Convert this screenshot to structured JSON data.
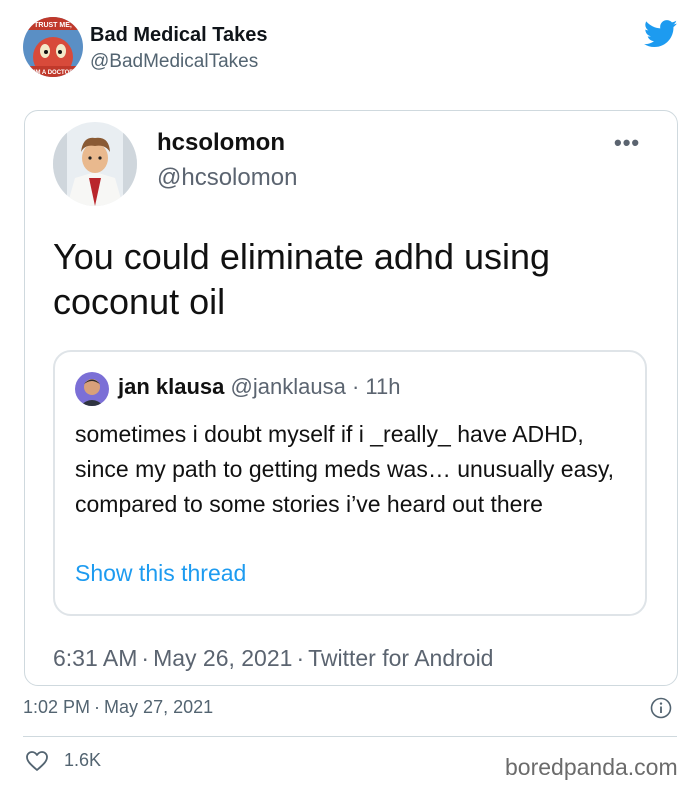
{
  "outer_tweet": {
    "author_name": "Bad Medical Takes",
    "author_handle": "@BadMedicalTakes",
    "avatar_text_top": "TRUST ME,",
    "avatar_text_bottom": "I'M A DOCTOR",
    "time": "1:02 PM",
    "date": "May 27, 2021",
    "like_count": "1.6K",
    "brand_color": "#1d9bf0"
  },
  "inner_tweet": {
    "author_name": "hcsolomon",
    "author_handle": "@hcsolomon",
    "more_label": "•••",
    "text": "You could eliminate adhd using coconut oil",
    "time": "6:31 AM",
    "date": "May 26, 2021",
    "source": "Twitter for Android"
  },
  "quoted_tweet": {
    "author_name": "jan klausa",
    "author_handle": "@janklausa",
    "age": "11h",
    "text": "sometimes i doubt myself if i _really_ have ADHD, since my path to getting meds was… unusually easy, compared to some stories i’ve heard out there",
    "show_thread_label": "Show this thread"
  },
  "watermark": "boredpanda.com",
  "separator": "·"
}
